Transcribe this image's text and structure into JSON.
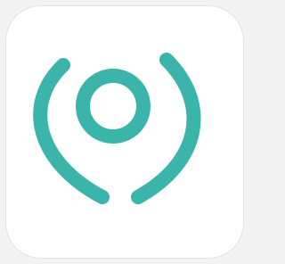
{
  "app_icon": {
    "icon_name": "location-pin-icon",
    "colors": {
      "glyph": "#3bb4aa",
      "tile": "#ffffff",
      "tile_border": "#e2e2e2",
      "background": "#f3f3f3"
    }
  }
}
